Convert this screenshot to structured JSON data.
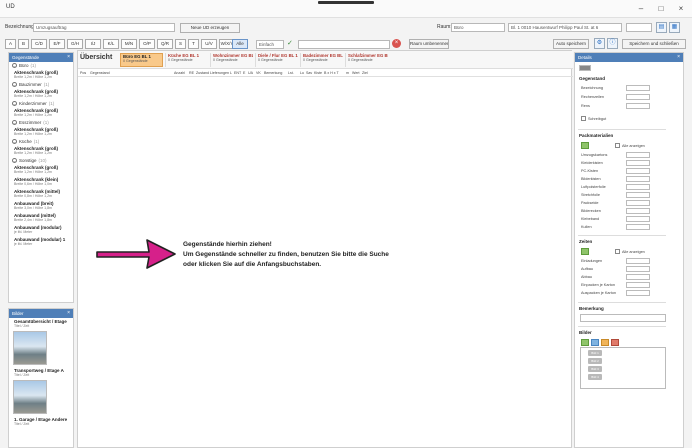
{
  "window": {
    "title": "UD",
    "min": "–",
    "max": "□",
    "close": "×"
  },
  "toolbar": {
    "bezeichnung_label": "Bezeichnung:",
    "bezeichnung_value": "Umzugsauftrag",
    "new_ud_button": "Neue UD erzeugen",
    "raum_label": "Raum:",
    "raum_value": "Büro",
    "person_value": "Bl. 1 0010 Hausentwurf Philipp Paul St. at 6",
    "new_room_button": "Raum umbenennen",
    "auto_button": "Auto speichern",
    "save_button": "Speichern und schließen"
  },
  "letters": [
    "A",
    "B",
    "C/D",
    "E/F",
    "G/H",
    "I/J",
    "K/L",
    "M/N",
    "O/P",
    "Q/R",
    "S",
    "T",
    "U/V",
    "W/X/Y",
    "Z"
  ],
  "filter": {
    "alle_label": "Alle",
    "einfach_value": "Einfach"
  },
  "left_panel": {
    "title": "Gegenstände",
    "rooms": [
      {
        "name": "Büro",
        "count": "(1)",
        "items": [
          {
            "t": "Aktenschrank (groß)",
            "s": "Breite 1,2m / Höhe 1,2m"
          }
        ]
      },
      {
        "name": "Bauzimmer",
        "count": "(1)",
        "items": [
          {
            "t": "Aktenschrank (groß)",
            "s": "Breite 1,2m / Höhe 1,2m"
          }
        ]
      },
      {
        "name": "Kinderzimmer",
        "count": "(1)",
        "items": [
          {
            "t": "Aktenschrank (groß)",
            "s": "Breite 1,2m / Höhe 1,2m"
          }
        ]
      },
      {
        "name": "Esszimmer",
        "count": "(1)",
        "items": [
          {
            "t": "Aktenschrank (groß)",
            "s": "Breite 1,2m / Höhe 1,2m"
          }
        ]
      },
      {
        "name": "Küche",
        "count": "(1)",
        "items": [
          {
            "t": "Aktenschrank (groß)",
            "s": "Breite 1,2m / Höhe 1,2m"
          }
        ]
      },
      {
        "name": "Sonstige",
        "count": "(10)",
        "items": [
          {
            "t": "Aktenschrank (groß)",
            "s": "Breite 1,2m / Höhe 1,2m"
          },
          {
            "t": "Aktenschrank (klein)",
            "s": "Breite 0,6m / Höhe 1,0m"
          },
          {
            "t": "Aktenschrank (mittel)",
            "s": "Breite 0,8m / Höhe 1,2m"
          },
          {
            "t": "Anbauwand (breit)",
            "s": "Breite 3,0m / Höhe 1,8m"
          },
          {
            "t": "Anbauwand (mittel)",
            "s": "Breite 2,4m / Höhe 1,8m"
          },
          {
            "t": "Anbauwand (modular)",
            "s": "je lfd. Meter"
          },
          {
            "t": "Anbauwand (modular) 1",
            "s": "je lfd. Meter"
          }
        ]
      }
    ]
  },
  "bottom_panel": {
    "title": "Bilder",
    "items": [
      {
        "t": "Gesamtübersicht / Etage",
        "s": "Titel / Zeit"
      },
      {
        "t": "Transportweg / Etage A",
        "s": "Titel / Zeit"
      },
      {
        "t": "1. Garage / Etage Andere",
        "s": "Titel / Zeit"
      }
    ]
  },
  "center": {
    "overview_tab": "Übersicht",
    "tabs": [
      {
        "t": "Büro EG BL 1",
        "s": "0 Gegenstände",
        "active": true
      },
      {
        "t": "Küche EG BL 1",
        "s": "0 Gegenstände",
        "active": false
      },
      {
        "t": "Wohnzimmer EG BL 1",
        "s": "0 Gegenstände",
        "active": false
      },
      {
        "t": "Diele / Flur EG BL 1",
        "s": "0 Gegenstände",
        "active": false
      },
      {
        "t": "Badezimmer EG BL 1",
        "s": "0 Gegenstände",
        "active": false
      },
      {
        "t": "Schlafzimmer EG BL 1",
        "s": "0 Gegenstände",
        "active": false
      }
    ],
    "columns": [
      "Pos",
      "Gegenstand",
      "Anzahl",
      "RE",
      "Zustand",
      "Lieferungen",
      "L",
      "ENT",
      "E",
      "UA",
      "VK",
      "Bemerkung",
      "Lst.",
      "Lu",
      "Sav",
      "Kiste",
      "B x H x T",
      "m",
      "Wert",
      "Ziel"
    ],
    "message": [
      "Gegenstände hierhin ziehen!",
      "Um Gegenstände schneller zu finden, benutzen Sie bitte die Suche",
      "oder klicken Sie auf die Anfangsbuchstaben."
    ]
  },
  "right_panel": {
    "title": "Details",
    "gegenstand": {
      "title": "Gegenstand",
      "fields": [
        "Bezeichnung",
        "Rechenzeilen",
        "Rens",
        "Schreibgut"
      ]
    },
    "packmaterialien": {
      "title": "Packmaterialien",
      "alle_label": "Alle anzeigen",
      "fields": [
        "Umzugskartons",
        "Kleiderkisten",
        "PC-Kisten",
        "Bilderkisten",
        "Luftpolsterfolie",
        "Stretchfolie",
        "Packseide",
        "Bilderecken",
        "Klebeband",
        "Kullen"
      ]
    },
    "zeiten": {
      "title": "Zeiten",
      "alle_label": "Alle anzeigen",
      "fields": [
        "Einladungen",
        "Aufbau",
        "Abbau",
        "Einpacken je Karton",
        "Auspacken je Karton"
      ]
    },
    "bemerkung": {
      "title": "Bemerkung"
    },
    "bilder": {
      "title": "Bilder",
      "pills": [
        "Bild 1",
        "Bild 2",
        "Bild 3",
        "Bild 4"
      ]
    }
  },
  "colors": {
    "accent": "#4f7fb8",
    "active_tab": "#f9c98a",
    "arrow": "#d6208a",
    "tab_text": "#b0362d"
  }
}
